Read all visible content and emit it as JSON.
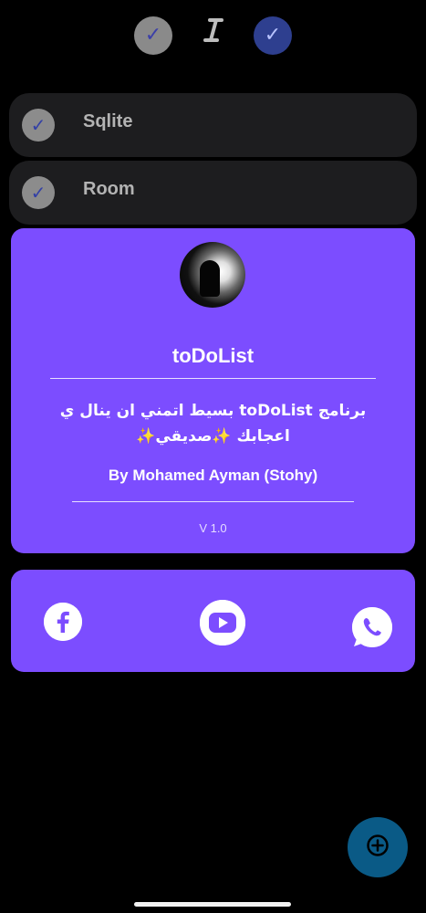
{
  "top_bar": {
    "icons": [
      "check-circle-icon",
      "italic-i-icon",
      "check-circle-icon"
    ]
  },
  "rows": [
    {
      "label": "Sqlite",
      "icon": "check-circle-icon"
    },
    {
      "label": "Room",
      "icon": "check-circle-icon"
    }
  ],
  "about": {
    "title": "toDoList",
    "description": "برنامج toDoList بسيط اتمني ان ينال ي اعجابك ✨صديقي✨",
    "author": "By Mohamed Ayman (Stohy)",
    "version": "V 1.0"
  },
  "social": {
    "icons": [
      "facebook-icon",
      "youtube-icon",
      "whatsapp-icon"
    ]
  },
  "fab": {
    "icon": "add-circle-icon"
  },
  "colors": {
    "background": "#000000",
    "card": "#7c4dff",
    "row": "#1d1d1f",
    "fab": "#0a5a86"
  }
}
